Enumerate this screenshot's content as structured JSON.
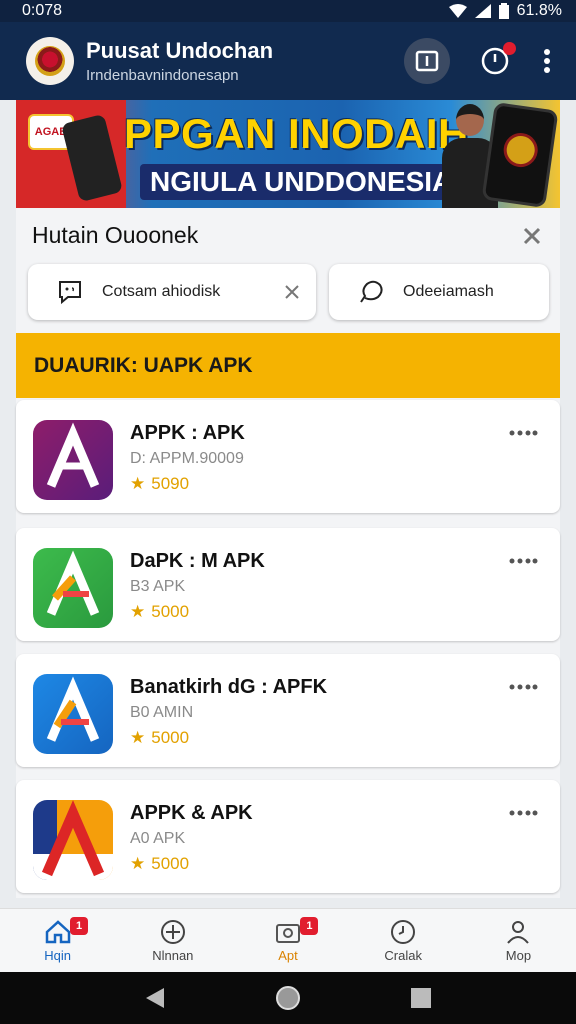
{
  "status": {
    "time": "0:078",
    "battery": "61.8%"
  },
  "app_bar": {
    "title": "Puusat Undochan",
    "subtitle": "Irndenbavnindonesapn"
  },
  "banner": {
    "headline": "PPGAN INODAIH",
    "subheadline": "NGIULA UNDDONESIA",
    "badge": "AGAB"
  },
  "sheet": {
    "title": "Hutain Ouoonek",
    "pill_left": "Cotsam ahiodisk",
    "pill_right": "Odeeiamash"
  },
  "section": {
    "title": "DUAURIK: UAPK APK"
  },
  "apps": [
    {
      "name": "APPK : APK",
      "meta": "D: APPM.90009",
      "rating": "5090"
    },
    {
      "name": "DaPK : M APK",
      "meta": "B3 APK",
      "rating": "5000"
    },
    {
      "name": "Banatkirh dG : APFK",
      "meta": "B0 AMIN",
      "rating": "5000"
    },
    {
      "name": "APPK & APK",
      "meta": "A0 APK",
      "rating": "5000"
    }
  ],
  "bottom_nav": [
    {
      "label": "Hqin",
      "badge": "1"
    },
    {
      "label": "Nlnnan"
    },
    {
      "label": "Apt",
      "badge": "1"
    },
    {
      "label": "Cralak"
    },
    {
      "label": "Mop"
    }
  ],
  "colors": {
    "app_bar": "#112a4f",
    "section_header": "#f5b301",
    "active_nav": "#1565c0"
  }
}
